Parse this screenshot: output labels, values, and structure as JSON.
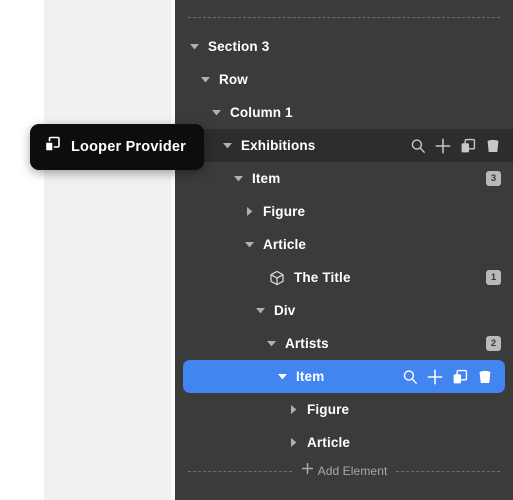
{
  "hover_chip": {
    "label": "Looper Provider",
    "icon": "duplicate-layers-icon",
    "background": "#0d0d0d",
    "text_color": "#ffffff"
  },
  "navigator": {
    "background": "#3b3b3b",
    "selected_color": "#4285f0",
    "open_row_color": "#2d2d2d",
    "rows": [
      {
        "label": "Section 3",
        "depth": 0,
        "disclosure": "expanded",
        "state": "plain",
        "badge": null,
        "icon": null,
        "actions": []
      },
      {
        "label": "Row",
        "depth": 1,
        "disclosure": "expanded",
        "state": "plain",
        "badge": null,
        "icon": null,
        "actions": []
      },
      {
        "label": "Column 1",
        "depth": 2,
        "disclosure": "expanded",
        "state": "plain",
        "badge": null,
        "icon": null,
        "actions": []
      },
      {
        "label": "Exhibitions",
        "depth": 3,
        "disclosure": "expanded",
        "state": "open",
        "badge": null,
        "icon": null,
        "actions": [
          "search-icon",
          "plus-icon",
          "duplicate-icon",
          "trash-icon"
        ]
      },
      {
        "label": "Item",
        "depth": 4,
        "disclosure": "expanded",
        "state": "plain",
        "badge": "3",
        "icon": null,
        "actions": []
      },
      {
        "label": "Figure",
        "depth": 5,
        "disclosure": "collapsed",
        "state": "plain",
        "badge": null,
        "icon": null,
        "actions": []
      },
      {
        "label": "Article",
        "depth": 5,
        "disclosure": "expanded",
        "state": "plain",
        "badge": null,
        "icon": null,
        "actions": []
      },
      {
        "label": "The Title",
        "depth": 6,
        "disclosure": "none",
        "state": "plain",
        "badge": "1",
        "icon": "cube-icon",
        "actions": []
      },
      {
        "label": "Div",
        "depth": 6,
        "disclosure": "expanded",
        "state": "plain",
        "badge": null,
        "icon": null,
        "actions": []
      },
      {
        "label": "Artists",
        "depth": 7,
        "disclosure": "expanded",
        "state": "plain",
        "badge": "2",
        "icon": null,
        "actions": []
      },
      {
        "label": "Item",
        "depth": 8,
        "disclosure": "expanded",
        "state": "selected",
        "badge": null,
        "icon": null,
        "actions": [
          "search-icon",
          "plus-icon",
          "duplicate-icon",
          "trash-icon"
        ]
      },
      {
        "label": "Figure",
        "depth": 9,
        "disclosure": "collapsed",
        "state": "plain",
        "badge": null,
        "icon": null,
        "actions": []
      },
      {
        "label": "Article",
        "depth": 9,
        "disclosure": "collapsed",
        "state": "plain",
        "badge": null,
        "icon": null,
        "actions": []
      }
    ],
    "add_element": {
      "label": "Add Element",
      "icon": "plus-icon"
    }
  }
}
